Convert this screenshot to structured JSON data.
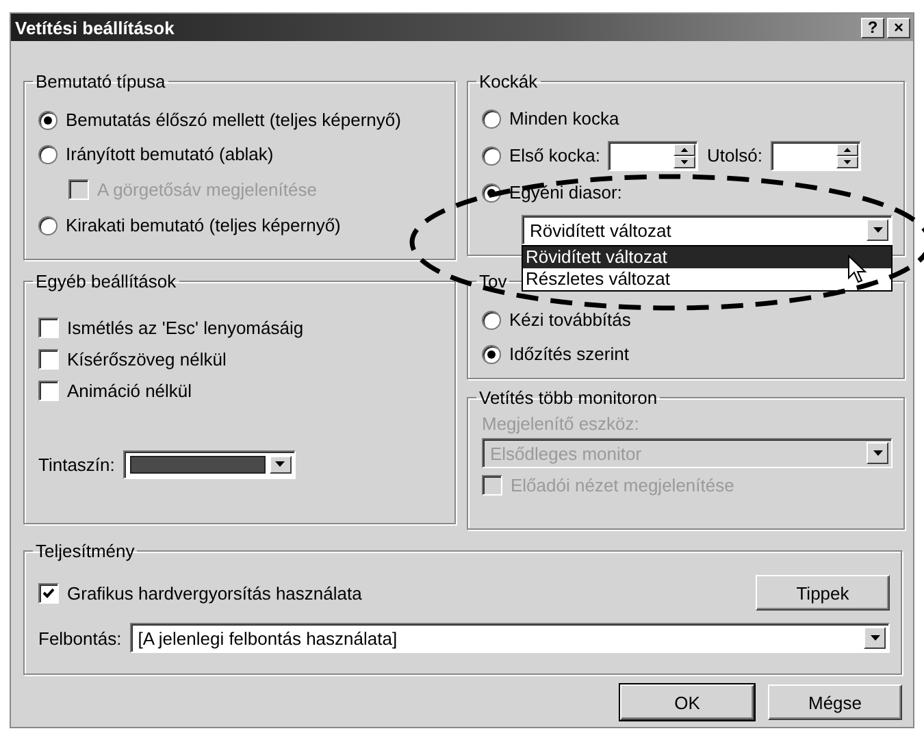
{
  "window": {
    "title": "Vetítési beállítások",
    "help_button": "?",
    "close_button": "×"
  },
  "show_type": {
    "title": "Bemutató típusa",
    "options": [
      {
        "label": "Bemutatás élőszó mellett (teljes képernyő)",
        "selected": true
      },
      {
        "label": "Irányított bemutató (ablak)",
        "selected": false,
        "children": [
          {
            "label": "A görgetősáv megjelenítése",
            "checked": false,
            "disabled": true
          }
        ]
      },
      {
        "label": "Kirakati bemutató (teljes képernyő)",
        "selected": false
      }
    ]
  },
  "slides": {
    "title": "Kockák",
    "options": [
      {
        "kind": "plain",
        "label": "Minden kocka",
        "selected": false
      },
      {
        "kind": "range",
        "label": "Első kocka:",
        "selected": false,
        "to_label": "Utolsó:"
      },
      {
        "kind": "custom",
        "label": "Egyéni diasor:",
        "selected": true,
        "dropdown": {
          "value": "Rövidített változat",
          "expanded": true,
          "items": [
            {
              "label": "Rövidített változat",
              "selected": true
            },
            {
              "label": "Részletes változat",
              "selected": false
            }
          ]
        }
      }
    ]
  },
  "other": {
    "title": "Egyéb beállítások",
    "checkboxes": [
      {
        "label": "Ismétlés az 'Esc' lenyomásáig",
        "checked": false
      },
      {
        "label": "Kísérőszöveg nélkül",
        "checked": false
      },
      {
        "label": "Animáció nélkül",
        "checked": false
      }
    ],
    "ink_label": "Tintaszín:"
  },
  "advance": {
    "title": "Tov",
    "options": [
      {
        "label": "Kézi továbbítás",
        "selected": false
      },
      {
        "label": "Időzítés szerint",
        "selected": true
      }
    ]
  },
  "monitors": {
    "title": "Vetítés több monitoron",
    "device_label": "Megjelenítő eszköz:",
    "device": "Elsődleges monitor",
    "disabled": true,
    "presenter_view": {
      "label": "Előadói nézet megjelenítése",
      "checked": false,
      "disabled": true
    }
  },
  "performance": {
    "title": "Teljesítmény",
    "hardware_acceleration": {
      "label": "Grafikus hardvergyorsítás használata",
      "checked": true
    },
    "tips_button": "Tippek",
    "resolution_label": "Felbontás:",
    "resolution": "[A jelenlegi felbontás használata]"
  },
  "buttons": [
    {
      "label": "OK",
      "default": true
    },
    {
      "label": "Mégse",
      "default": false
    }
  ]
}
